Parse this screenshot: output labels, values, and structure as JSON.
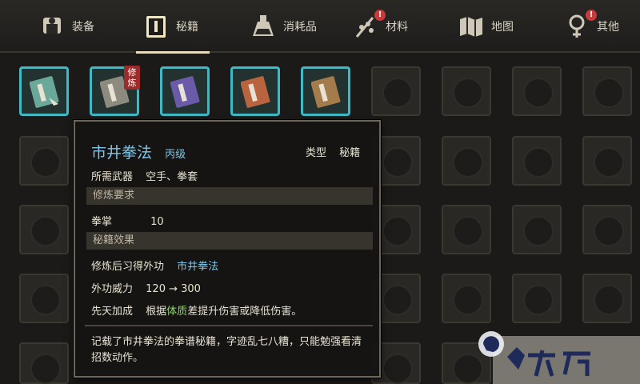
{
  "tabs": [
    {
      "label": "装备",
      "icon": "armor-icon",
      "badge": false
    },
    {
      "label": "秘籍",
      "icon": "book-icon",
      "badge": false,
      "active": true
    },
    {
      "label": "消耗品",
      "icon": "potion-icon",
      "badge": false
    },
    {
      "label": "材料",
      "icon": "herb-icon",
      "badge": true
    },
    {
      "label": "地图",
      "icon": "map-icon",
      "badge": false
    },
    {
      "label": "其他",
      "icon": "misc-icon",
      "badge": true
    }
  ],
  "badge_symbol": "!",
  "items": [
    {
      "name": "teal-manual",
      "color": "#6aa89a"
    },
    {
      "name": "grey-manual",
      "color": "#8d8a80",
      "tag": "修炼"
    },
    {
      "name": "purple-manual",
      "color": "#6a5aa8"
    },
    {
      "name": "red-manual",
      "color": "#b9643f"
    },
    {
      "name": "brown-manual",
      "color": "#a47b4b"
    }
  ],
  "tooltip": {
    "title": "市井拳法",
    "grade": "丙级",
    "type_label": "类型",
    "type_value": "秘籍",
    "weapon_label": "所需武器",
    "weapon_value": "空手、拳套",
    "req_section": "修炼要求",
    "req_label": "拳掌",
    "req_value": "10",
    "effect_section": "秘籍效果",
    "learn_label": "修炼后习得外功",
    "learn_value": "市井拳法",
    "power_label": "外功威力",
    "power_value": "120 → 300",
    "innate_label": "先天加成",
    "innate_pre": "根据",
    "innate_key": "体质",
    "innate_post": "差提升伤害或降低伤害。",
    "description": "记载了市井拳法的拳谱秘籍，字迹乱七八糟，只能勉强看清招数动作。"
  },
  "colors": {
    "accent": "#3fb9c4",
    "title": "#7fc6e8",
    "highlight": "#8fd36a",
    "badge": "#c93a3a"
  }
}
